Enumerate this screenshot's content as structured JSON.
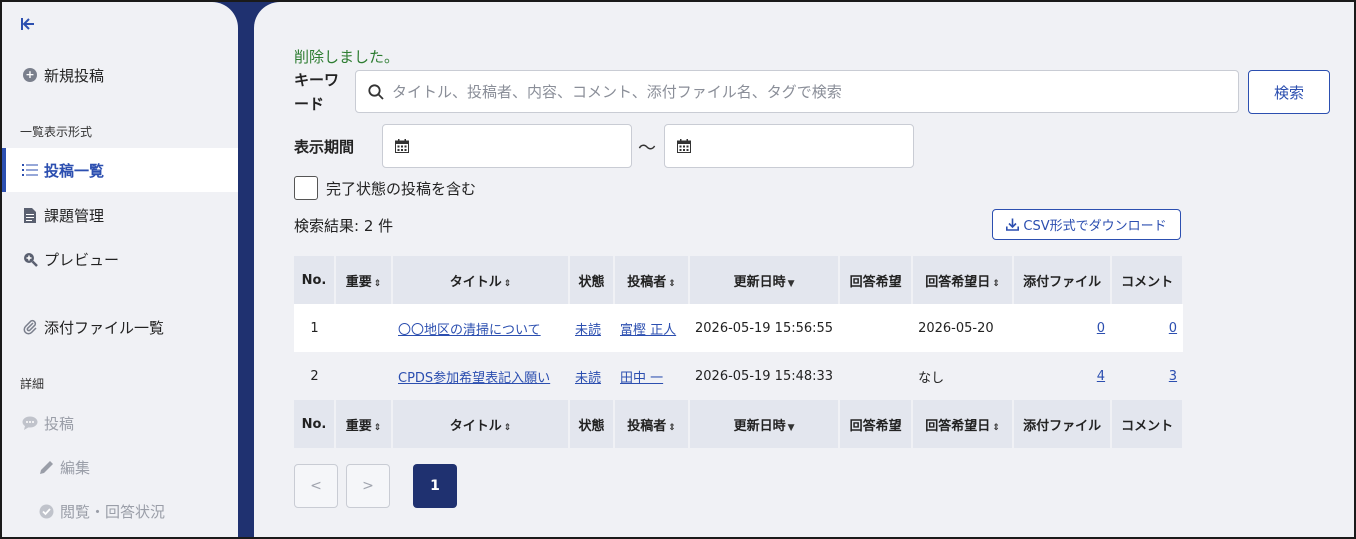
{
  "sidebar": {
    "collapse_icon": "collapse-left-icon",
    "new_post": "新規投稿",
    "section_list_format": "一覧表示形式",
    "post_list": "投稿一覧",
    "issue_management": "課題管理",
    "preview": "プレビュー",
    "attachment_list": "添付ファイル一覧",
    "section_detail": "詳細",
    "post": "投稿",
    "edit": "編集",
    "view_answer_status": "閲覧・回答状況"
  },
  "main": {
    "message": "削除しました。",
    "keyword_label": "キーワード",
    "search_placeholder": "タイトル、投稿者、内容、コメント、添付ファイル名、タグで検索",
    "search_button": "検索",
    "period_label": "表示期間",
    "tilde": "〜",
    "include_completed": "完了状態の投稿を含む",
    "result_text": "検索結果: 2 件",
    "csv_button": "CSV形式でダウンロード"
  },
  "table": {
    "headers": [
      "No.",
      "重要",
      "タイトル",
      "状態",
      "投稿者",
      "更新日時",
      "回答希望",
      "回答希望日",
      "添付ファイル",
      "コメント"
    ],
    "rows": [
      {
        "no": "1",
        "important": "",
        "title": "〇〇地区の清掃について",
        "status": "未読",
        "author": "富樫 正人",
        "updated": "2026-05-19 15:56:55",
        "answer_request": "",
        "answer_date": "2026-05-20",
        "attachments": "0",
        "comments": "0"
      },
      {
        "no": "2",
        "important": "",
        "title": "CPDS参加希望表記入願い",
        "status": "未読",
        "author": "田中 一",
        "updated": "2026-05-19 15:48:33",
        "answer_request": "",
        "answer_date": "なし",
        "attachments": "4",
        "comments": "3"
      }
    ]
  },
  "pagination": {
    "prev": "<",
    "next": ">",
    "current": "1"
  },
  "colors": {
    "accent": "#2c4fb0",
    "navy": "#1f3170",
    "success": "#2e7d32"
  }
}
